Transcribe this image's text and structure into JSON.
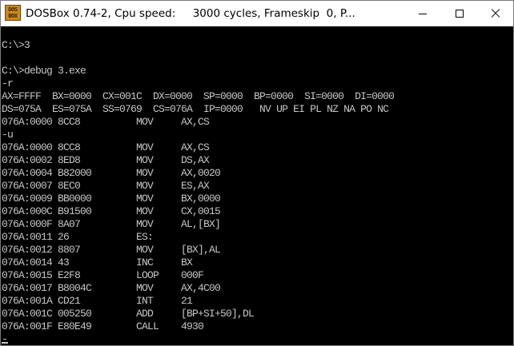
{
  "window": {
    "title": "DOSBox 0.74-2, Cpu speed:     3000 cycles, Frameskip  0, P...",
    "icon_text": [
      "DOS",
      "BOX"
    ],
    "icon_name": "dosbox-app-icon",
    "controls": [
      "minimize-icon",
      "maximize-icon",
      "close-icon"
    ]
  },
  "console": {
    "lines": [
      "",
      "C:\\>3",
      "",
      "C:\\>debug 3.exe",
      "-r",
      "AX=FFFF  BX=0000  CX=001C  DX=0000  SP=0000  BP=0000  SI=0000  DI=0000",
      "DS=075A  ES=075A  SS=0769  CS=076A  IP=0000   NV UP EI PL NZ NA PO NC",
      "076A:0000 8CC8          MOV     AX,CS",
      "-u",
      "076A:0000 8CC8          MOV     AX,CS",
      "076A:0002 8ED8          MOV     DS,AX",
      "076A:0004 B82000        MOV     AX,0020",
      "076A:0007 8EC0          MOV     ES,AX",
      "076A:0009 BB0000        MOV     BX,0000",
      "076A:000C B91500        MOV     CX,0015",
      "076A:000F 8A07          MOV     AL,[BX]",
      "076A:0011 26            ES:",
      "076A:0012 8807          MOV     [BX],AL",
      "076A:0014 43            INC     BX",
      "076A:0015 E2F8          LOOP    000F",
      "076A:0017 B8004C        MOV     AX,4C00",
      "076A:001A CD21          INT     21",
      "076A:001C 005250        ADD     [BP+SI+50],DL",
      "076A:001F E80E49        CALL    4930",
      "-"
    ]
  },
  "colors": {
    "screen_bg": "#000000",
    "screen_text": "#c6c6c6",
    "titlebar_bg": "#ffffff"
  }
}
